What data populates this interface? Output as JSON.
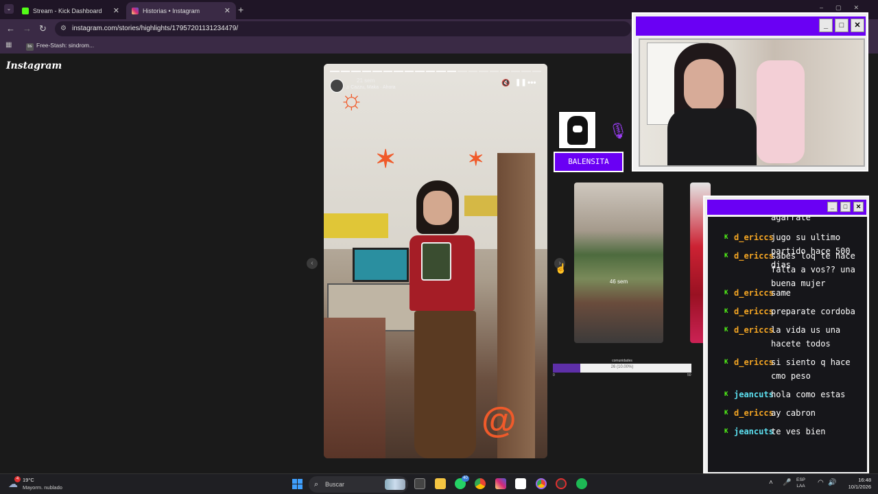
{
  "browser": {
    "tabs": [
      {
        "label": "Stream - Kick Dashboard",
        "favicon_color": "#53fc18"
      },
      {
        "label": "Historias • Instagram",
        "favicon_color": "#d62976"
      }
    ],
    "url": "instagram.com/stories/highlights/17957201131234479/",
    "bookmark": "Free-Stash: sindrom...",
    "bookmark_icon_text": "bs"
  },
  "instagram": {
    "logo": "Instagram",
    "story": {
      "time": "21 sem",
      "song": "Cazzu, Maka · Ahora",
      "progress_total_segments": 20,
      "progress_active_segments": 12
    },
    "preview_label": "46 sem"
  },
  "stream": {
    "streamer_name": "BALENSITA",
    "goal": {
      "label": "comunidades",
      "text": "26 (10.00%)",
      "fraction": 0.2,
      "min": "0",
      "max": "50"
    },
    "chat": {
      "top_text": "agarrate",
      "messages": [
        {
          "user": "d_ericcs",
          "text": "jugo su ultimo partido hace 500 dias",
          "color": "#f5a623"
        },
        {
          "user": "d_ericcs",
          "text": "sabes loq te hace falta a vos?? una buena mujer",
          "color": "#f5a623"
        },
        {
          "user": "d_ericcs",
          "text": "same",
          "color": "#f5a623"
        },
        {
          "user": "d_ericcs",
          "text": "preparate cordoba",
          "color": "#f5a623"
        },
        {
          "user": "d_ericcs",
          "text": "la vida us una hacete todos",
          "color": "#f5a623"
        },
        {
          "user": "d_ericcs",
          "text": "si siento q hace cmo peso",
          "color": "#f5a623"
        },
        {
          "user": "jeancuts",
          "text": "hola como estas",
          "color": "#5ce0f0"
        },
        {
          "user": "d_ericcs",
          "text": "ay cabron",
          "color": "#f5a623"
        },
        {
          "user": "jeancuts",
          "text": "te ves bien",
          "color": "#5ce0f0"
        }
      ]
    },
    "accent_color": "#6a00f4"
  },
  "taskbar": {
    "weather_temp": "19°C",
    "weather_desc": "Mayorm. nublado",
    "weather_badge": "4",
    "search_placeholder": "Buscar",
    "whatsapp_badge": "40",
    "lang_top": "ESP",
    "lang_bottom": "LAA",
    "time": "16:48",
    "date": "10/1/2026"
  }
}
